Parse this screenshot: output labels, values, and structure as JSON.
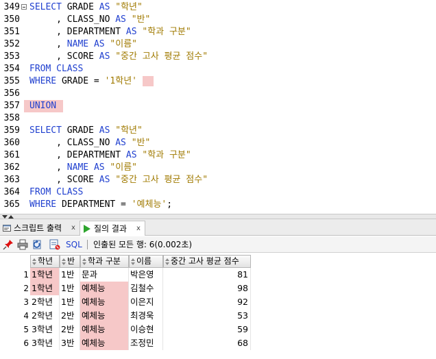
{
  "editor": {
    "lines": [
      {
        "num": "349",
        "fold": true,
        "tokens": [
          {
            "t": "SELECT",
            "c": "kw"
          },
          {
            "t": " GRADE ",
            "c": ""
          },
          {
            "t": "AS",
            "c": "kw"
          },
          {
            "t": " \"학년\"",
            "c": "str"
          }
        ]
      },
      {
        "num": "350",
        "tokens": [
          {
            "t": "     , CLASS_NO ",
            "c": ""
          },
          {
            "t": "AS",
            "c": "kw"
          },
          {
            "t": " \"반\"",
            "c": "str"
          }
        ]
      },
      {
        "num": "351",
        "tokens": [
          {
            "t": "     , DEPARTMENT ",
            "c": ""
          },
          {
            "t": "AS",
            "c": "kw"
          },
          {
            "t": " \"학과 구분\"",
            "c": "str"
          }
        ]
      },
      {
        "num": "352",
        "tokens": [
          {
            "t": "     , ",
            "c": ""
          },
          {
            "t": "NAME",
            "c": "kw"
          },
          {
            "t": " ",
            "c": ""
          },
          {
            "t": "AS",
            "c": "kw"
          },
          {
            "t": " \"이름\"",
            "c": "str"
          }
        ]
      },
      {
        "num": "353",
        "tokens": [
          {
            "t": "     , SCORE ",
            "c": ""
          },
          {
            "t": "AS",
            "c": "kw"
          },
          {
            "t": " \"중간 고사 평균 점수\"",
            "c": "str"
          }
        ]
      },
      {
        "num": "354",
        "tokens": [
          {
            "t": "FROM",
            "c": "kw"
          },
          {
            "t": " CLASS",
            "c": "kw"
          }
        ]
      },
      {
        "num": "355",
        "tokens": [
          {
            "t": "WHERE",
            "c": "kw"
          },
          {
            "t": " GRADE = ",
            "c": ""
          },
          {
            "t": "'1학년'",
            "c": "str"
          }
        ],
        "trail_hl": true
      },
      {
        "num": "356",
        "tokens": []
      },
      {
        "num": "357",
        "tokens": [
          {
            "t": "UNION",
            "c": "kw"
          }
        ],
        "line_hl": true
      },
      {
        "num": "358",
        "tokens": []
      },
      {
        "num": "359",
        "tokens": [
          {
            "t": "SELECT",
            "c": "kw"
          },
          {
            "t": " GRADE ",
            "c": ""
          },
          {
            "t": "AS",
            "c": "kw"
          },
          {
            "t": " \"학년\"",
            "c": "str"
          }
        ]
      },
      {
        "num": "360",
        "tokens": [
          {
            "t": "     , CLASS_NO ",
            "c": ""
          },
          {
            "t": "AS",
            "c": "kw"
          },
          {
            "t": " \"반\"",
            "c": "str"
          }
        ]
      },
      {
        "num": "361",
        "tokens": [
          {
            "t": "     , DEPARTMENT ",
            "c": ""
          },
          {
            "t": "AS",
            "c": "kw"
          },
          {
            "t": " \"학과 구분\"",
            "c": "str"
          }
        ]
      },
      {
        "num": "362",
        "tokens": [
          {
            "t": "     , ",
            "c": ""
          },
          {
            "t": "NAME",
            "c": "kw"
          },
          {
            "t": " ",
            "c": ""
          },
          {
            "t": "AS",
            "c": "kw"
          },
          {
            "t": " \"이름\"",
            "c": "str"
          }
        ]
      },
      {
        "num": "363",
        "tokens": [
          {
            "t": "     , SCORE ",
            "c": ""
          },
          {
            "t": "AS",
            "c": "kw"
          },
          {
            "t": " \"중간 고사 평균 점수\"",
            "c": "str"
          }
        ]
      },
      {
        "num": "364",
        "tokens": [
          {
            "t": "FROM",
            "c": "kw"
          },
          {
            "t": " CLASS",
            "c": "kw"
          }
        ]
      },
      {
        "num": "365",
        "tokens": [
          {
            "t": "WHERE",
            "c": "kw"
          },
          {
            "t": " DEPARTMENT = ",
            "c": ""
          },
          {
            "t": "'예체능'",
            "c": "str"
          },
          {
            "t": ";",
            "c": ""
          }
        ]
      }
    ]
  },
  "tabs": {
    "script_output": {
      "label": "스크립트 출력",
      "close": "x"
    },
    "query_result": {
      "label": "질의 결과",
      "close": "x"
    }
  },
  "toolbar": {
    "sql_label": "SQL",
    "status": "인출된 모든 행: 6(0.002초)",
    "icons": [
      "pin-icon",
      "print-icon",
      "refresh-icon",
      "export-icon"
    ]
  },
  "grid": {
    "columns": [
      "학년",
      "반",
      "학과 구분",
      "이름",
      "중간 고사 평균 점수"
    ],
    "rows": [
      {
        "n": "1",
        "grade": "1학년",
        "cls": "1반",
        "dept": "문과",
        "name": "박은영",
        "score": "81",
        "hl_grade": true,
        "hl_dept": false
      },
      {
        "n": "2",
        "grade": "1학년",
        "cls": "1반",
        "dept": "예체능",
        "name": "김철수",
        "score": "98",
        "hl_grade": true,
        "hl_dept": true
      },
      {
        "n": "3",
        "grade": "2학년",
        "cls": "1반",
        "dept": "예체능",
        "name": "이은지",
        "score": "92",
        "hl_grade": false,
        "hl_dept": true
      },
      {
        "n": "4",
        "grade": "2학년",
        "cls": "2반",
        "dept": "예체능",
        "name": "최경욱",
        "score": "53",
        "hl_grade": false,
        "hl_dept": true
      },
      {
        "n": "5",
        "grade": "3학년",
        "cls": "2반",
        "dept": "예체능",
        "name": "이승현",
        "score": "59",
        "hl_grade": false,
        "hl_dept": true
      },
      {
        "n": "6",
        "grade": "3학년",
        "cls": "3반",
        "dept": "예체능",
        "name": "조정민",
        "score": "68",
        "hl_grade": false,
        "hl_dept": true
      }
    ]
  },
  "colors": {
    "keyword": "#1f3fcf",
    "string": "#a07a00",
    "highlight": "#f6c8c8"
  }
}
